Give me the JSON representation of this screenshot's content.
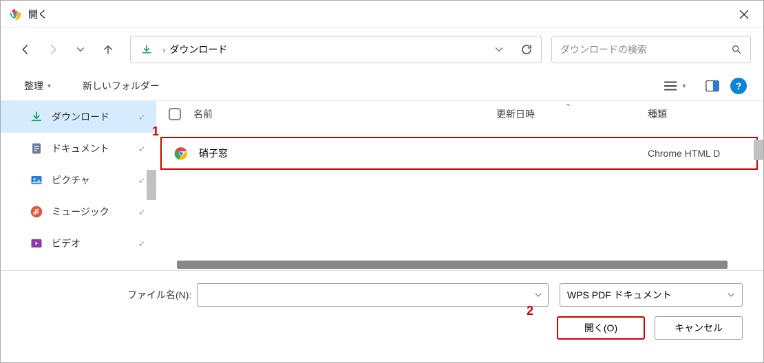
{
  "title": "開く",
  "path": {
    "location": "ダウンロード"
  },
  "search": {
    "placeholder": "ダウンロードの検索"
  },
  "toolbar": {
    "organize": "整理",
    "new_folder": "新しいフォルダー"
  },
  "sidebar": {
    "items": [
      {
        "label": "ダウンロード",
        "icon": "download"
      },
      {
        "label": "ドキュメント",
        "icon": "document"
      },
      {
        "label": "ピクチャ",
        "icon": "picture"
      },
      {
        "label": "ミュージック",
        "icon": "music"
      },
      {
        "label": "ビデオ",
        "icon": "video"
      }
    ]
  },
  "columns": {
    "name": "名前",
    "modified": "更新日時",
    "type": "種類"
  },
  "files": [
    {
      "name": "硝子窓",
      "type": "Chrome HTML D",
      "icon": "chrome"
    }
  ],
  "footer": {
    "filename_label": "ファイル名(N):",
    "filter": "WPS PDF ドキュメント",
    "open": "開く(O)",
    "cancel": "キャンセル"
  },
  "annotations": {
    "a1": "1",
    "a2": "2"
  }
}
